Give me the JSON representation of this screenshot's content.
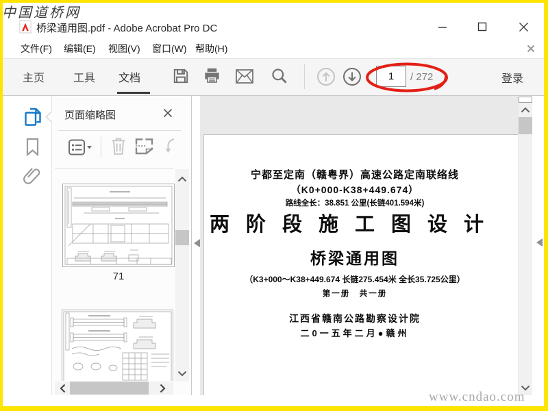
{
  "watermarks": {
    "top_left": "中国道桥网",
    "bottom_right": "www.cndao.com"
  },
  "titlebar": {
    "title": "桥梁通用图.pdf - Adobe Acrobat Pro DC"
  },
  "menubar": {
    "items": [
      "文件(F)",
      "编辑(E)",
      "视图(V)",
      "窗口(W)",
      "帮助(H)"
    ]
  },
  "toolbar": {
    "tabs": [
      {
        "label": "主页",
        "active": false
      },
      {
        "label": "工具",
        "active": false
      },
      {
        "label": "文档",
        "active": true
      }
    ],
    "page_current": "1",
    "page_total_display": "/ 272",
    "sign_in": "登录"
  },
  "left_rail": {
    "items": [
      {
        "name": "page-thumbnails",
        "active": true
      },
      {
        "name": "bookmarks",
        "active": false
      },
      {
        "name": "attachments",
        "active": false
      }
    ]
  },
  "thumbnails_panel": {
    "title": "页面缩略图",
    "thumb1_label": "71"
  },
  "doc_page": {
    "line1": "宁都至定南（赣粤界）高速公路定南联络线",
    "line2": "（K0+000-K38+449.674）",
    "line3": "路线全长：38.851 公里(长链401.594米)",
    "main_title": "两阶段施工图设计",
    "sub_title": "桥梁通用图",
    "line6": "（K3+000～K38+449.674 长链275.454米 全长35.725公里）",
    "line7": "第一册　共一册",
    "line8": "江西省赣南公路勘察设计院",
    "line9": "二0一五年二月●赣州"
  },
  "icons": {
    "toolbar": [
      "save-icon",
      "print-icon",
      "email-icon",
      "search-icon",
      "page-up-icon",
      "page-down-icon"
    ],
    "left_rail": [
      "page-thumbnails-icon",
      "bookmarks-icon",
      "attachments-icon"
    ],
    "panel_toolbar": [
      "thumbnail-options-icon",
      "delete-pages-icon",
      "crop-pages-icon",
      "rotate-pages-icon"
    ]
  },
  "colors": {
    "frame_yellow": "#ffe400",
    "annotation_red": "#e32016",
    "active_blue": "#1478c8"
  }
}
